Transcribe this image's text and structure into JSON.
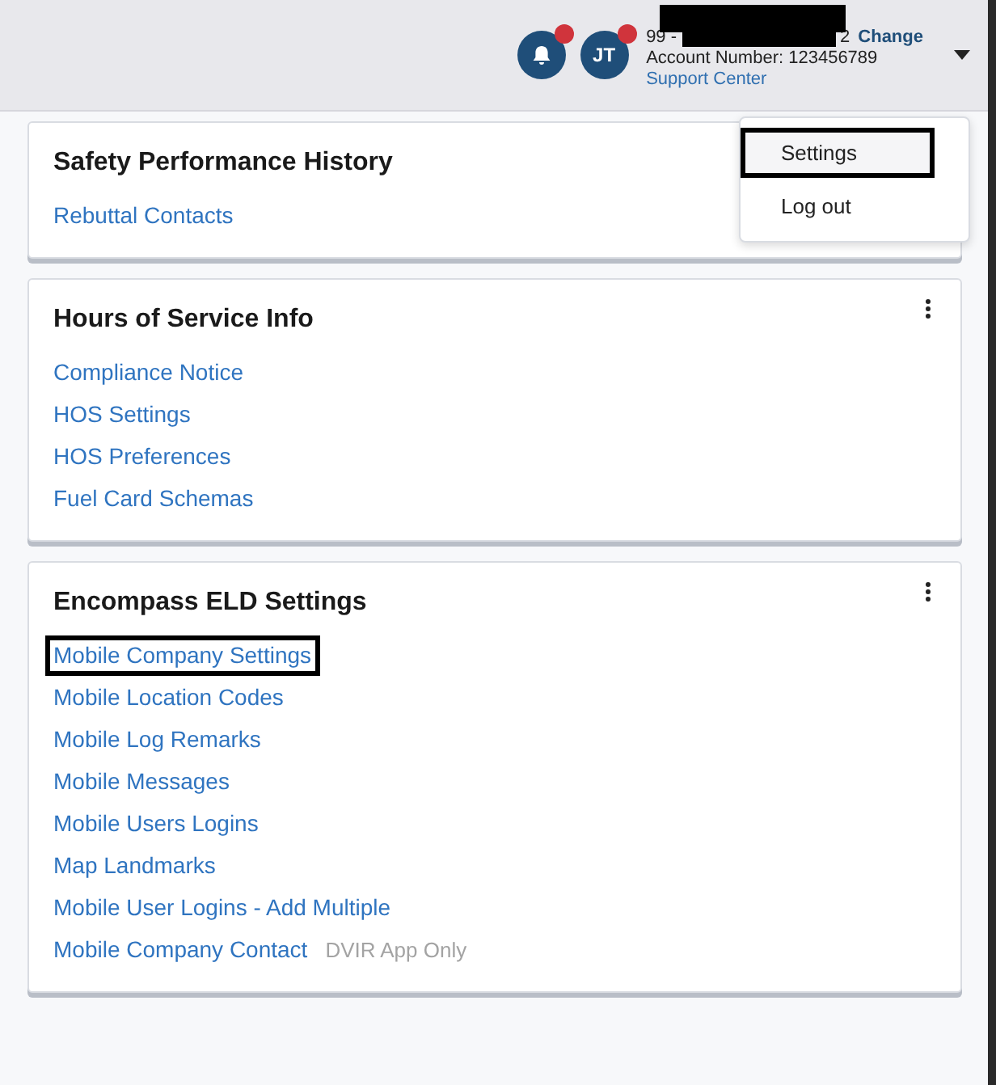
{
  "header": {
    "notifications": {
      "badge": true
    },
    "avatar": {
      "initials": "JT",
      "badge": true
    },
    "account": {
      "name_start": "99 -",
      "name_end": "2",
      "change_link": "Change",
      "number": "Account Number: 123456789",
      "support_link": "Support Center"
    }
  },
  "user_menu": {
    "items": [
      {
        "label": "Settings",
        "highlighted": true
      },
      {
        "label": "Log out",
        "highlighted": false
      }
    ]
  },
  "cards": [
    {
      "title": "Safety Performance History",
      "links": [
        {
          "label": "Rebuttal Contacts",
          "highlighted": false
        }
      ]
    },
    {
      "title": "Hours of Service Info",
      "links": [
        {
          "label": "Compliance Notice",
          "highlighted": false
        },
        {
          "label": "HOS Settings",
          "highlighted": false
        },
        {
          "label": "HOS Preferences",
          "highlighted": false
        },
        {
          "label": "Fuel Card Schemas",
          "highlighted": false
        }
      ]
    },
    {
      "title": "Encompass ELD Settings",
      "links": [
        {
          "label": "Mobile Company Settings",
          "highlighted": true
        },
        {
          "label": "Mobile Location Codes",
          "highlighted": false
        },
        {
          "label": "Mobile Log Remarks",
          "highlighted": false
        },
        {
          "label": "Mobile Messages",
          "highlighted": false
        },
        {
          "label": "Mobile Users Logins",
          "highlighted": false
        },
        {
          "label": "Map Landmarks",
          "highlighted": false
        },
        {
          "label": "Mobile User Logins - Add Multiple",
          "highlighted": false
        },
        {
          "label": "Mobile Company Contact",
          "note": "DVIR App Only",
          "highlighted": false
        }
      ]
    }
  ]
}
